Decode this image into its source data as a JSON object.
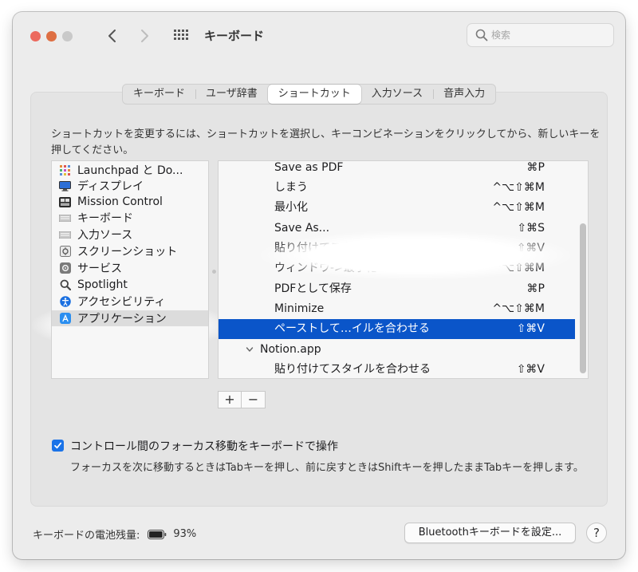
{
  "window": {
    "title": "キーボード",
    "search_placeholder": "検索"
  },
  "tabs": [
    {
      "label": "キーボード"
    },
    {
      "label": "ユーザ辞書"
    },
    {
      "label": "ショートカット",
      "active": true
    },
    {
      "label": "入力ソース"
    },
    {
      "label": "音声入力"
    }
  ],
  "description": "ショートカットを変更するには、ショートカットを選択し、キーコンビネーションをクリックしてから、新しいキーを押してください。",
  "categories": [
    {
      "label": "Launchpad と Do...",
      "icon": "launchpad-icon"
    },
    {
      "label": "ディスプレイ",
      "icon": "display-icon"
    },
    {
      "label": "Mission Control",
      "icon": "mission-control-icon"
    },
    {
      "label": "キーボード",
      "icon": "keyboard-icon"
    },
    {
      "label": "入力ソース",
      "icon": "input-sources-icon"
    },
    {
      "label": "スクリーンショット",
      "icon": "screenshot-icon"
    },
    {
      "label": "サービス",
      "icon": "services-gear-icon"
    },
    {
      "label": "Spotlight",
      "icon": "spotlight-magnifier-icon"
    },
    {
      "label": "アクセシビリティ",
      "icon": "accessibility-icon"
    },
    {
      "label": "アプリケーション",
      "icon": "app-store-icon",
      "selected": true
    }
  ],
  "shortcuts": [
    {
      "name": "Save as PDF",
      "keys": "⌘P"
    },
    {
      "name": "しまう",
      "keys": "^⌥⇧⌘M"
    },
    {
      "name": "最小化",
      "keys": "^⌥⇧⌘M"
    },
    {
      "name": "Save As...",
      "keys": "⇧⌘S"
    },
    {
      "name": "貼り付けてスタイルを合わせる",
      "keys": "⇧⌘V"
    },
    {
      "name": "ウィンドウ->最小化",
      "keys": "^⌥⇧⌘M"
    },
    {
      "name": "PDFとして保存",
      "keys": "⌘P"
    },
    {
      "name": "Minimize",
      "keys": "^⌥⇧⌘M"
    },
    {
      "name": "ペーストして…イルを合わせる",
      "keys": "⇧⌘V",
      "selected": true
    },
    {
      "name": "Notion.app",
      "keys": "",
      "group": true
    },
    {
      "name": "貼り付けてスタイルを合わせる",
      "keys": "⇧⌘V"
    }
  ],
  "add_button": "+",
  "remove_button": "−",
  "focus_checkbox": {
    "label": "コントロール間のフォーカス移動をキーボードで操作",
    "checked": true,
    "description": "フォーカスを次に移動するときはTabキーを押し、前に戻すときはShiftキーを押したままTabキーを押します。"
  },
  "battery": {
    "label": "キーボードの電池残量:",
    "percent": "93%",
    "level": 0.93
  },
  "bluetooth_button": "Bluetoothキーボードを設定...",
  "help_button": "?",
  "colors": {
    "selection": "#0a55c9",
    "checkbox": "#1a73e8",
    "close": "#ec6a5e",
    "minimize": "#de6f43"
  }
}
